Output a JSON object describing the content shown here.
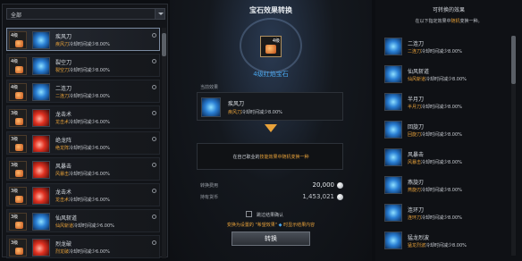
{
  "filter": {
    "selected": "全部"
  },
  "left_list": [
    {
      "level": "4级",
      "skill_name": "疾风刀",
      "skill_color": "blue",
      "desc_skill": "疾风刀",
      "desc_rest": "冷却时间减少8.00%",
      "selected": true
    },
    {
      "level": "4级",
      "skill_name": "裂空刀",
      "skill_color": "blue",
      "desc_skill": "裂空刀",
      "desc_rest": "冷却时间减少8.00%",
      "selected": false
    },
    {
      "level": "4级",
      "skill_name": "二连刀",
      "skill_color": "blue",
      "desc_skill": "二连刀",
      "desc_rest": "冷却时间减少8.00%",
      "selected": false
    },
    {
      "level": "3级",
      "skill_name": "龙击术",
      "skill_color": "red",
      "desc_skill": "龙击术",
      "desc_rest": "冷却时间减少6.00%",
      "selected": false
    },
    {
      "level": "3级",
      "skill_name": "绝龙阵",
      "skill_color": "red",
      "desc_skill": "绝龙阵",
      "desc_rest": "冷却时间减少6.00%",
      "selected": false
    },
    {
      "level": "3级",
      "skill_name": "风暴击",
      "skill_color": "red",
      "desc_skill": "风暴击",
      "desc_rest": "冷却时间减少6.00%",
      "selected": false
    },
    {
      "level": "3级",
      "skill_name": "龙击术",
      "skill_color": "red",
      "desc_skill": "龙击术",
      "desc_rest": "冷却时间减少6.00%",
      "selected": false
    },
    {
      "level": "3级",
      "skill_name": "仙风斩道",
      "skill_color": "blue",
      "desc_skill": "仙风斩道",
      "desc_rest": "冷却时间减少6.00%",
      "selected": false
    },
    {
      "level": "3级",
      "skill_name": "烈龙破",
      "skill_color": "red",
      "desc_skill": "烈龙破",
      "desc_rest": "冷却时间减少6.00%",
      "selected": false
    }
  ],
  "center": {
    "title": "宝石效果转换",
    "gem_level": "4级",
    "gem_name": "4级红焰宝石",
    "current_effect_label": "当前效果",
    "current_effect": {
      "name": "疾风刀",
      "desc_skill": "疾风刀",
      "desc_rest": "冷却时间减少8.00%"
    },
    "info_prefix": "在自己职业的",
    "info_highlight": "技能效果中随机变换一种",
    "cost_label": "转换费用",
    "cost_value": "20,000",
    "owned_label": "持有货币",
    "owned_value": "1,453,021",
    "skip_label": "跳过结果确认",
    "warning": "变换为设置的 \"希望效果\"",
    "warning_star": "◆",
    "warning_tail": "时显示结果内容",
    "convert_button": "转换"
  },
  "right": {
    "title": "可转换的效果",
    "subtitle_prefix": "在以下指定效果中",
    "subtitle_highlight": "随机",
    "subtitle_suffix": "变换一种。",
    "items": [
      {
        "name": "二连刀",
        "desc_skill": "二连刀",
        "desc_rest": "冷却时间减少8.00%"
      },
      {
        "name": "仙风斩道",
        "desc_skill": "仙风斩道",
        "desc_rest": "冷却时间减少8.00%"
      },
      {
        "name": "半月刀",
        "desc_skill": "半月刀",
        "desc_rest": "冷却时间减少8.00%"
      },
      {
        "name": "回旋刀",
        "desc_skill": "回旋刀",
        "desc_rest": "冷却时间减少8.00%"
      },
      {
        "name": "风暴击",
        "desc_skill": "风暴击",
        "desc_rest": "冷却时间减少8.00%"
      },
      {
        "name": "燕旋刃",
        "desc_skill": "燕旋刃",
        "desc_rest": "冷却时间减少8.00%"
      },
      {
        "name": "连环刀",
        "desc_skill": "连环刀",
        "desc_rest": "冷却时间减少8.00%"
      },
      {
        "name": "猛龙烈波",
        "desc_skill": "猛龙烈波",
        "desc_rest": "冷却时间减少8.00%"
      }
    ]
  },
  "colors": {
    "accent_gold": "#e8a23a",
    "accent_blue": "#4aa8f0"
  }
}
